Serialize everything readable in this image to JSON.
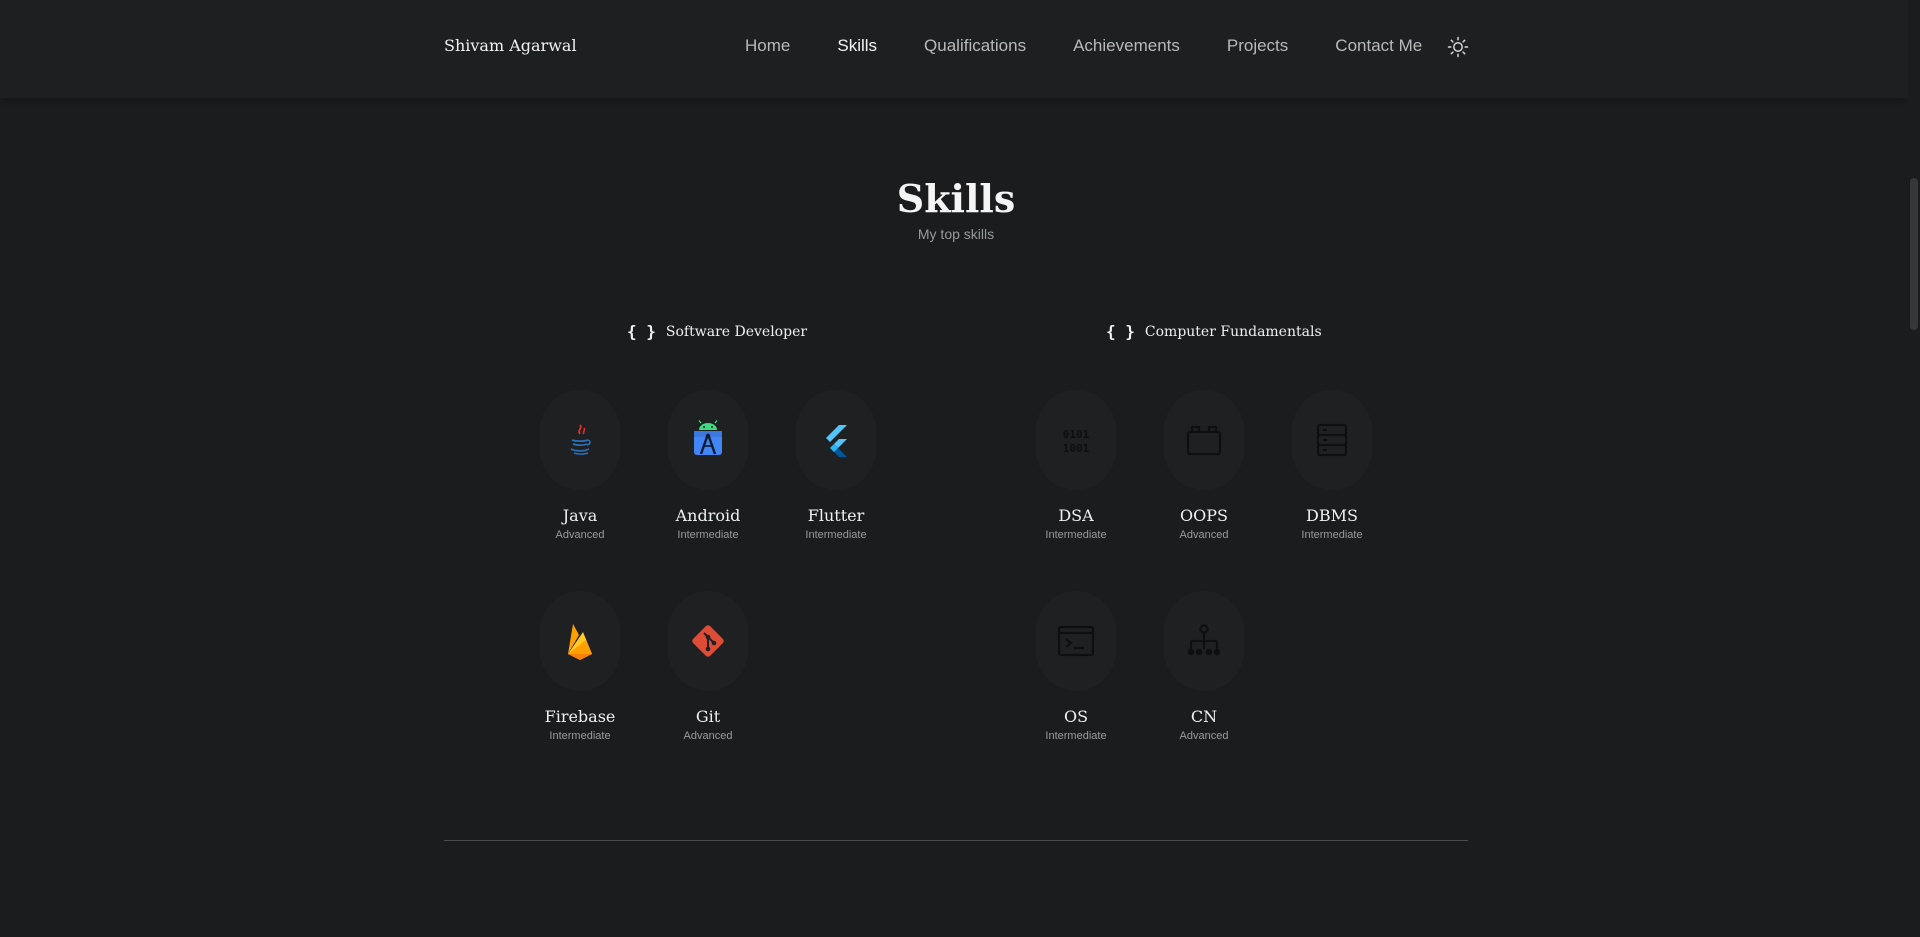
{
  "header": {
    "logo": "Shivam Agarwal",
    "nav": [
      {
        "label": "Home",
        "active": false
      },
      {
        "label": "Skills",
        "active": true
      },
      {
        "label": "Qualifications",
        "active": false
      },
      {
        "label": "Achievements",
        "active": false
      },
      {
        "label": "Projects",
        "active": false
      },
      {
        "label": "Contact Me",
        "active": false
      }
    ],
    "theme_toggle_icon": "sun-icon"
  },
  "section": {
    "title": "Skills",
    "subtitle": "My top skills"
  },
  "categories": [
    {
      "braces": "{ }",
      "title": "Software Developer",
      "skills": [
        {
          "name": "Java",
          "level": "Advanced",
          "icon": "java-icon"
        },
        {
          "name": "Android",
          "level": "Intermediate",
          "icon": "android-studio-icon"
        },
        {
          "name": "Flutter",
          "level": "Intermediate",
          "icon": "flutter-icon"
        },
        {
          "name": "Firebase",
          "level": "Intermediate",
          "icon": "firebase-icon"
        },
        {
          "name": "Git",
          "level": "Advanced",
          "icon": "git-icon"
        }
      ]
    },
    {
      "braces": "{ }",
      "title": "Computer Fundamentals",
      "skills": [
        {
          "name": "DSA",
          "level": "Intermediate",
          "icon": "binary-icon"
        },
        {
          "name": "OOPS",
          "level": "Advanced",
          "icon": "box-icon"
        },
        {
          "name": "DBMS",
          "level": "Intermediate",
          "icon": "database-table-icon"
        },
        {
          "name": "OS",
          "level": "Intermediate",
          "icon": "terminal-icon"
        },
        {
          "name": "CN",
          "level": "Advanced",
          "icon": "network-icon"
        }
      ]
    }
  ]
}
